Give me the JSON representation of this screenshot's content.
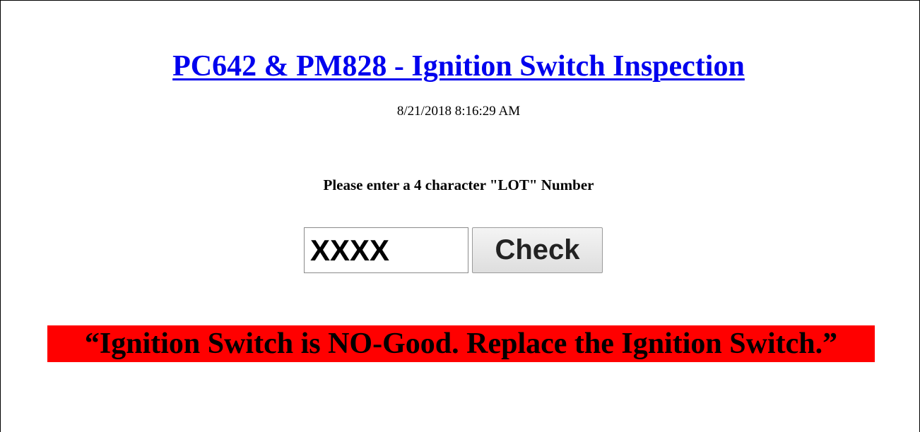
{
  "header": {
    "title": "PC642 & PM828 - Ignition Switch Inspection",
    "timestamp": "8/21/2018 8:16:29 AM"
  },
  "form": {
    "prompt": "Please enter a 4 character \"LOT\" Number",
    "lot_input_value": "XXXX",
    "check_label": "Check"
  },
  "result": {
    "message": "“Ignition Switch is NO-Good. Replace the Ignition Switch.”",
    "background_color": "#ff0000"
  },
  "colors": {
    "link": "#0000ee",
    "text": "#000000"
  }
}
